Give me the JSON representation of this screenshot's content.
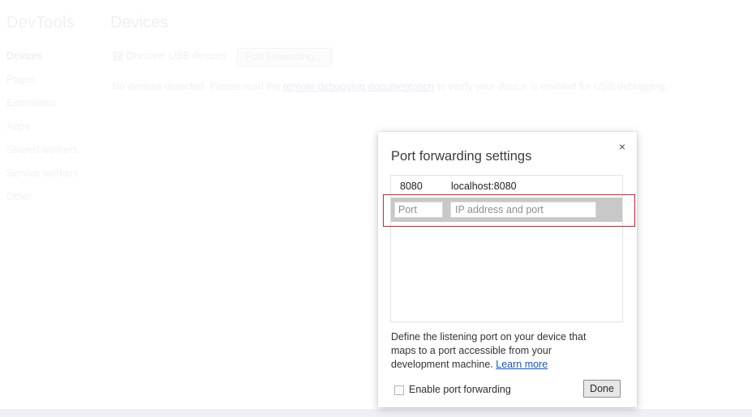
{
  "sidebar": {
    "title": "DevTools",
    "items": [
      {
        "label": "Devices",
        "selected": true
      },
      {
        "label": "Pages",
        "selected": false
      },
      {
        "label": "Extensions",
        "selected": false
      },
      {
        "label": "Apps",
        "selected": false
      },
      {
        "label": "Shared workers",
        "selected": false
      },
      {
        "label": "Service workers",
        "selected": false
      },
      {
        "label": "Other",
        "selected": false
      }
    ]
  },
  "content": {
    "title": "Devices",
    "discover_usb_label": "Discover USB devices",
    "discover_usb_checked": true,
    "port_forwarding_button": "Port forwarding…",
    "status_prefix": "No devices detected. Please read the ",
    "status_link": "remote debugging documentation",
    "status_suffix": " to verify your device is enabled for USB debugging."
  },
  "dialog": {
    "title": "Port forwarding settings",
    "close_label": "×",
    "rows": [
      {
        "port": "8080",
        "address": "localhost:8080"
      }
    ],
    "edit_row": {
      "port_value": "",
      "port_placeholder": "Port",
      "address_value": "",
      "address_placeholder": "IP address and port"
    },
    "description_text": "Define the listening port on your device that maps to a port accessible from your development machine. ",
    "description_link": "Learn more",
    "enable_label": "Enable port forwarding",
    "enable_checked": false,
    "done_label": "Done",
    "highlight_color": "#c6223b"
  }
}
